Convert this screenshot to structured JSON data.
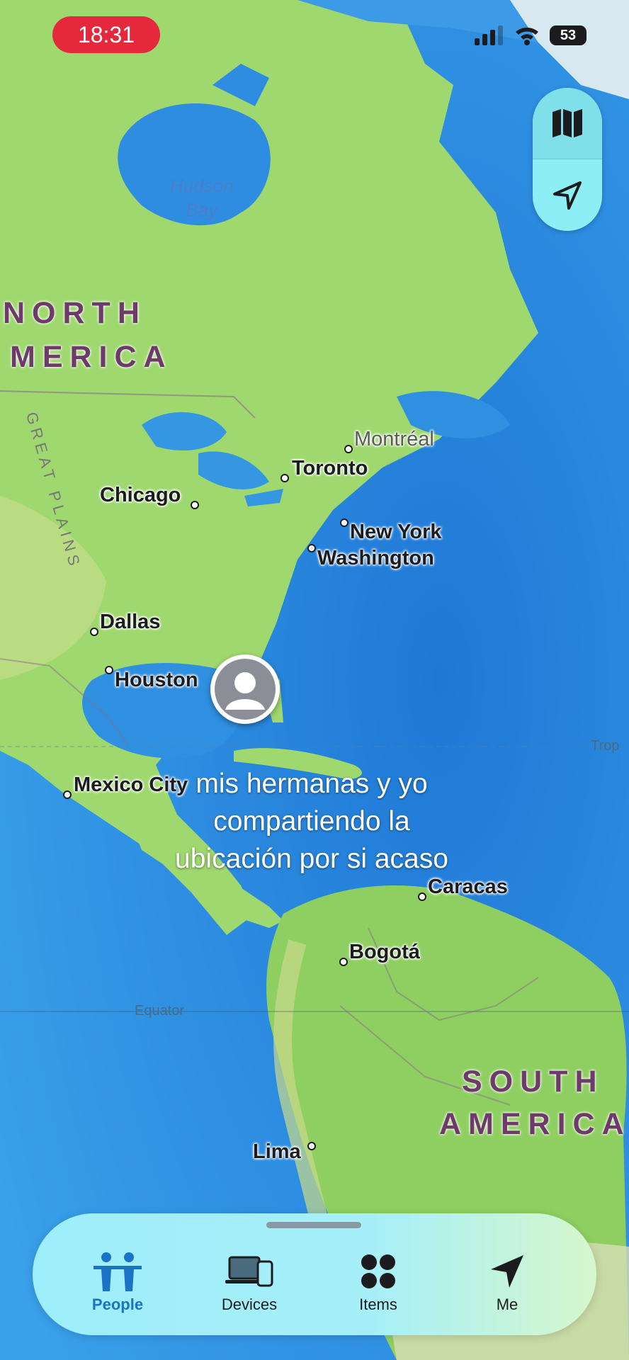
{
  "status_bar": {
    "time": "18:31",
    "battery": "53",
    "signal_icon": "cellular-signal-icon",
    "wifi_icon": "wifi-icon"
  },
  "map_controls": {
    "map_mode_icon": "map-icon",
    "location_icon": "location-arrow-icon"
  },
  "map": {
    "continents": [
      "NORTH",
      "MERICA",
      "SOUTH",
      "AMERICA"
    ],
    "water_labels": [
      "Hudson",
      "Bay"
    ],
    "region_labels": [
      "GREAT PLAINS"
    ],
    "cities": [
      "Montréal",
      "Toronto",
      "Chicago",
      "New York",
      "Washington",
      "Dallas",
      "Houston",
      "Mexico City",
      "Caracas",
      "Bogotá",
      "Lima"
    ],
    "lines": {
      "equator": "Equator",
      "tropic": "Trop"
    }
  },
  "overlay_caption": [
    "mis hermanas y yo",
    "compartiendo la",
    "ubicación por si acaso"
  ],
  "tab_bar": {
    "tabs": [
      {
        "label": "People",
        "icon": "people-icon",
        "active": true
      },
      {
        "label": "Devices",
        "icon": "devices-icon",
        "active": false
      },
      {
        "label": "Items",
        "icon": "items-icon",
        "active": false
      },
      {
        "label": "Me",
        "icon": "me-location-icon",
        "active": false
      }
    ]
  },
  "colors": {
    "ocean": "#2f8fe0",
    "land": "#9fd86e",
    "active_tab": "#1a73c8",
    "recording_pill": "#e5283c"
  }
}
